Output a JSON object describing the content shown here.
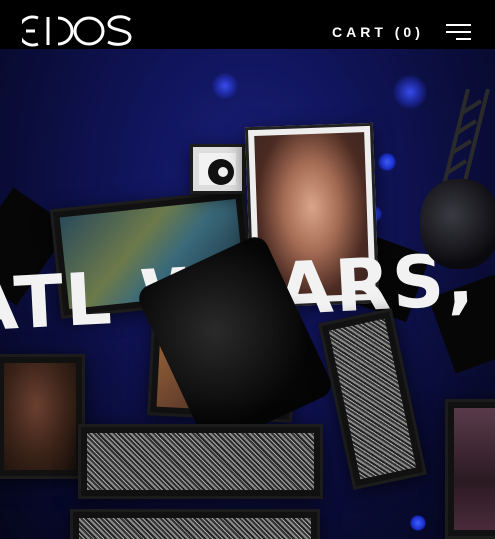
{
  "header": {
    "logo_text": "EIDOS",
    "cart_label": "CART (0)",
    "menu_icon": "hamburger-menu-icon"
  },
  "hero": {
    "headline": "ATL WI  ARS,"
  },
  "colors": {
    "header_bg": "#000000",
    "scene_bg": "#10145a",
    "accent_blue": "#2a40f0",
    "text": "#ffffff"
  }
}
